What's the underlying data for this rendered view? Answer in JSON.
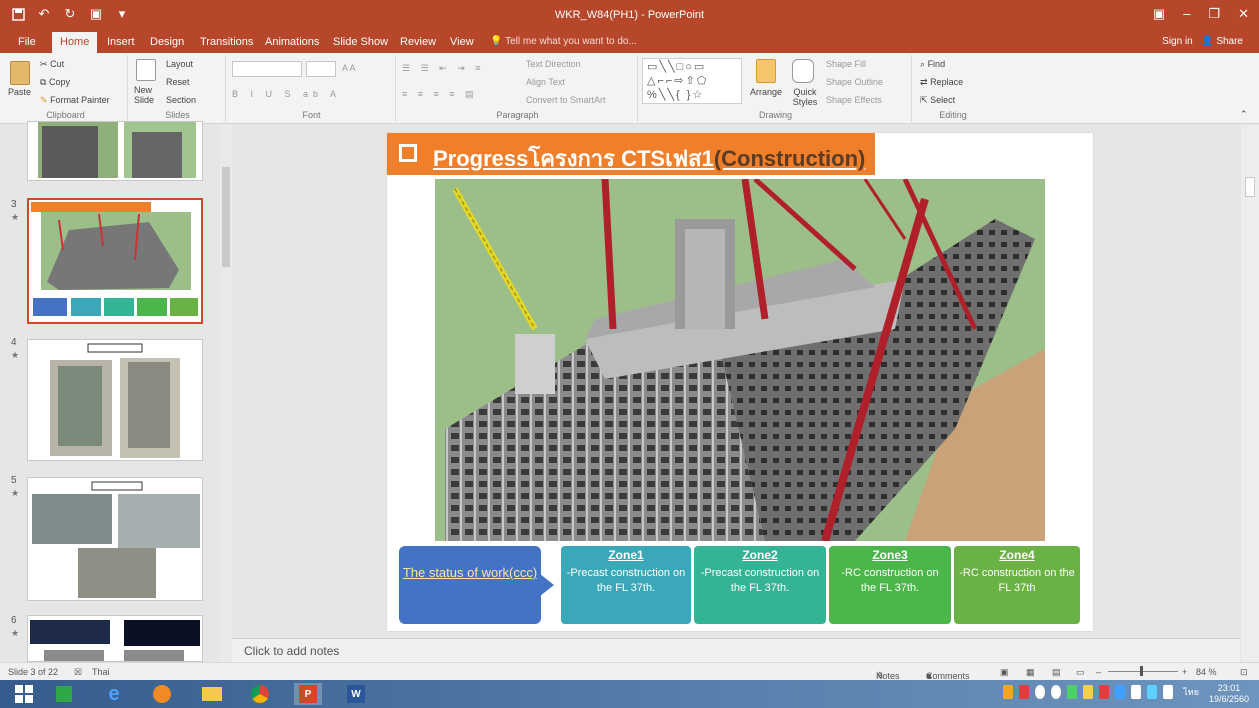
{
  "window": {
    "title": "WKR_W84(PH1) - PowerPoint"
  },
  "tabs": [
    "File",
    "Home",
    "Insert",
    "Design",
    "Transitions",
    "Animations",
    "Slide Show",
    "Review",
    "View"
  ],
  "tell_me": "Tell me what you want to do...",
  "account": {
    "sign_in": "Sign in",
    "share": "Share"
  },
  "ribbon": {
    "clipboard": {
      "paste": "Paste",
      "cut": "Cut",
      "copy": "Copy",
      "format_painter": "Format Painter",
      "label": "Clipboard"
    },
    "slides": {
      "new_slide": "New Slide",
      "layout": "Layout",
      "reset": "Reset",
      "section": "Section",
      "label": "Slides"
    },
    "font": {
      "label": "Font"
    },
    "paragraph": {
      "text_direction": "Text Direction",
      "align_text": "Align Text",
      "convert_smartart": "Convert to SmartArt",
      "label": "Paragraph"
    },
    "drawing": {
      "arrange": "Arrange",
      "quick_styles": "Quick Styles",
      "shape_fill": "Shape Fill",
      "shape_outline": "Shape Outline",
      "shape_effects": "Shape Effects",
      "label": "Drawing"
    },
    "editing": {
      "find": "Find",
      "replace": "Replace",
      "select": "Select",
      "label": "Editing"
    }
  },
  "thumbnails": [
    {
      "num": "3",
      "selected": true
    },
    {
      "num": "4"
    },
    {
      "num": "5"
    },
    {
      "num": "6"
    }
  ],
  "slide": {
    "title_part1": "Progressโครงการ CTSเฟส1",
    "title_part2": "(Construction)",
    "status_label": "The status of work(ccc)",
    "zones": [
      {
        "title": "Zone1",
        "desc": "-Precast construction on the FL 37th.",
        "color": "#3aa8b8"
      },
      {
        "title": "Zone2",
        "desc": "-Precast construction on the FL 37th.",
        "color": "#35b396"
      },
      {
        "title": "Zone3",
        "desc": "-RC construction on the  FL 37th.",
        "color": "#4bb64a"
      },
      {
        "title": "Zone4",
        "desc": "-RC construction on the  FL 37th",
        "color": "#6bb244"
      }
    ]
  },
  "notes": "Click to add notes",
  "statusbar": {
    "slide": "Slide 3 of 22",
    "lang": "Thai",
    "notes": "Notes",
    "comments": "Comments",
    "zoom": "84 %"
  },
  "clock": {
    "time": "23:01",
    "date": "19/6/2560"
  },
  "tray_lang": "ไทย"
}
